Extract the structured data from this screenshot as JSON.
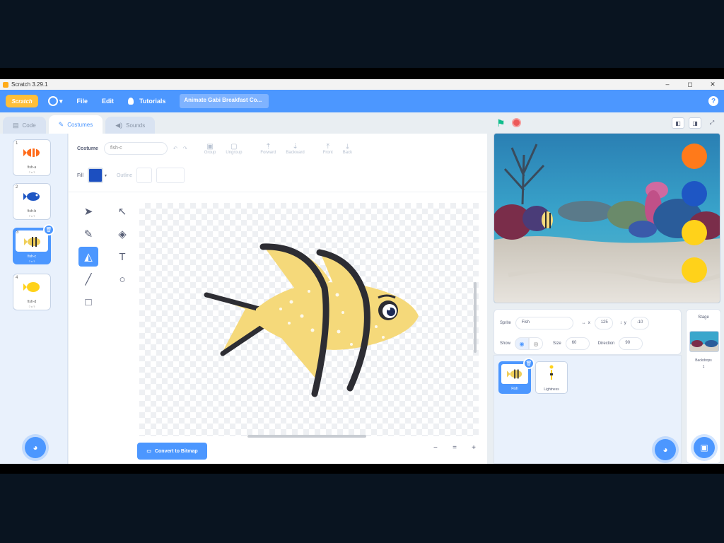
{
  "window": {
    "title": "Scratch 3.29.1",
    "controls": [
      "–",
      "◻",
      "✕"
    ]
  },
  "menubar": {
    "logo_text": "Scratch",
    "file": "File",
    "edit": "Edit",
    "tutorials": "Tutorials",
    "project_title": "Animate Gabi Breakfast Co...",
    "help": "?"
  },
  "tabs": [
    {
      "label": "Code",
      "icon": "code-icon"
    },
    {
      "label": "Costumes",
      "icon": "brush-icon"
    },
    {
      "label": "Sounds",
      "icon": "speaker-icon"
    }
  ],
  "costumes": [
    {
      "number": "1",
      "name": "fish-a",
      "size": "? x ?",
      "color": "#ff6b1a"
    },
    {
      "number": "2",
      "name": "fish-b",
      "size": "? x ?",
      "color": "#1e56c4"
    },
    {
      "number": "3",
      "name": "fish-c",
      "size": "? x ?",
      "color": "#f0cf5a"
    },
    {
      "number": "4",
      "name": "fish-d",
      "size": "? x ?",
      "color": "#ffd21a"
    }
  ],
  "editor": {
    "costume_label": "Costume",
    "costume_name": "fish-c",
    "group": "Group",
    "ungroup": "Ungroup",
    "forward": "Forward",
    "backward": "Backward",
    "front": "Front",
    "back": "Back",
    "fill_label": "Fill",
    "fill_color": "#1c4fc0",
    "outline_label": "Outline",
    "convert_button": "Convert to Bitmap",
    "zoom_out": "−",
    "zoom_reset": "=",
    "zoom_in": "+"
  },
  "tools": [
    {
      "name": "select-tool",
      "glyph": "➤"
    },
    {
      "name": "reshape-tool",
      "glyph": "↖"
    },
    {
      "name": "brush-tool",
      "glyph": "🖌"
    },
    {
      "name": "eraser-tool",
      "glyph": "◆"
    },
    {
      "name": "fill-tool",
      "glyph": "⛟"
    },
    {
      "name": "text-tool",
      "glyph": "T"
    },
    {
      "name": "line-tool",
      "glyph": "╱"
    },
    {
      "name": "circle-tool",
      "glyph": "○"
    },
    {
      "name": "rectangle-tool",
      "glyph": "□"
    }
  ],
  "sprite_info": {
    "sprite_label": "Sprite",
    "sprite_name": "Fish",
    "x_label": "x",
    "x_value": "125",
    "y_label": "y",
    "y_value": "-10",
    "show_label": "Show",
    "size_label": "Size",
    "size_value": "60",
    "direction_label": "Direction",
    "direction_value": "90"
  },
  "sprites": [
    {
      "name": "Fish"
    },
    {
      "name": "Lightness"
    }
  ],
  "stage_panel": {
    "label": "Stage",
    "backdrops_label": "Backdrops",
    "backdrops_count": "1"
  },
  "stage_color_circles": [
    "#ff7a1a",
    "#1e56c4",
    "#ffd21a",
    "#ffd21a"
  ]
}
